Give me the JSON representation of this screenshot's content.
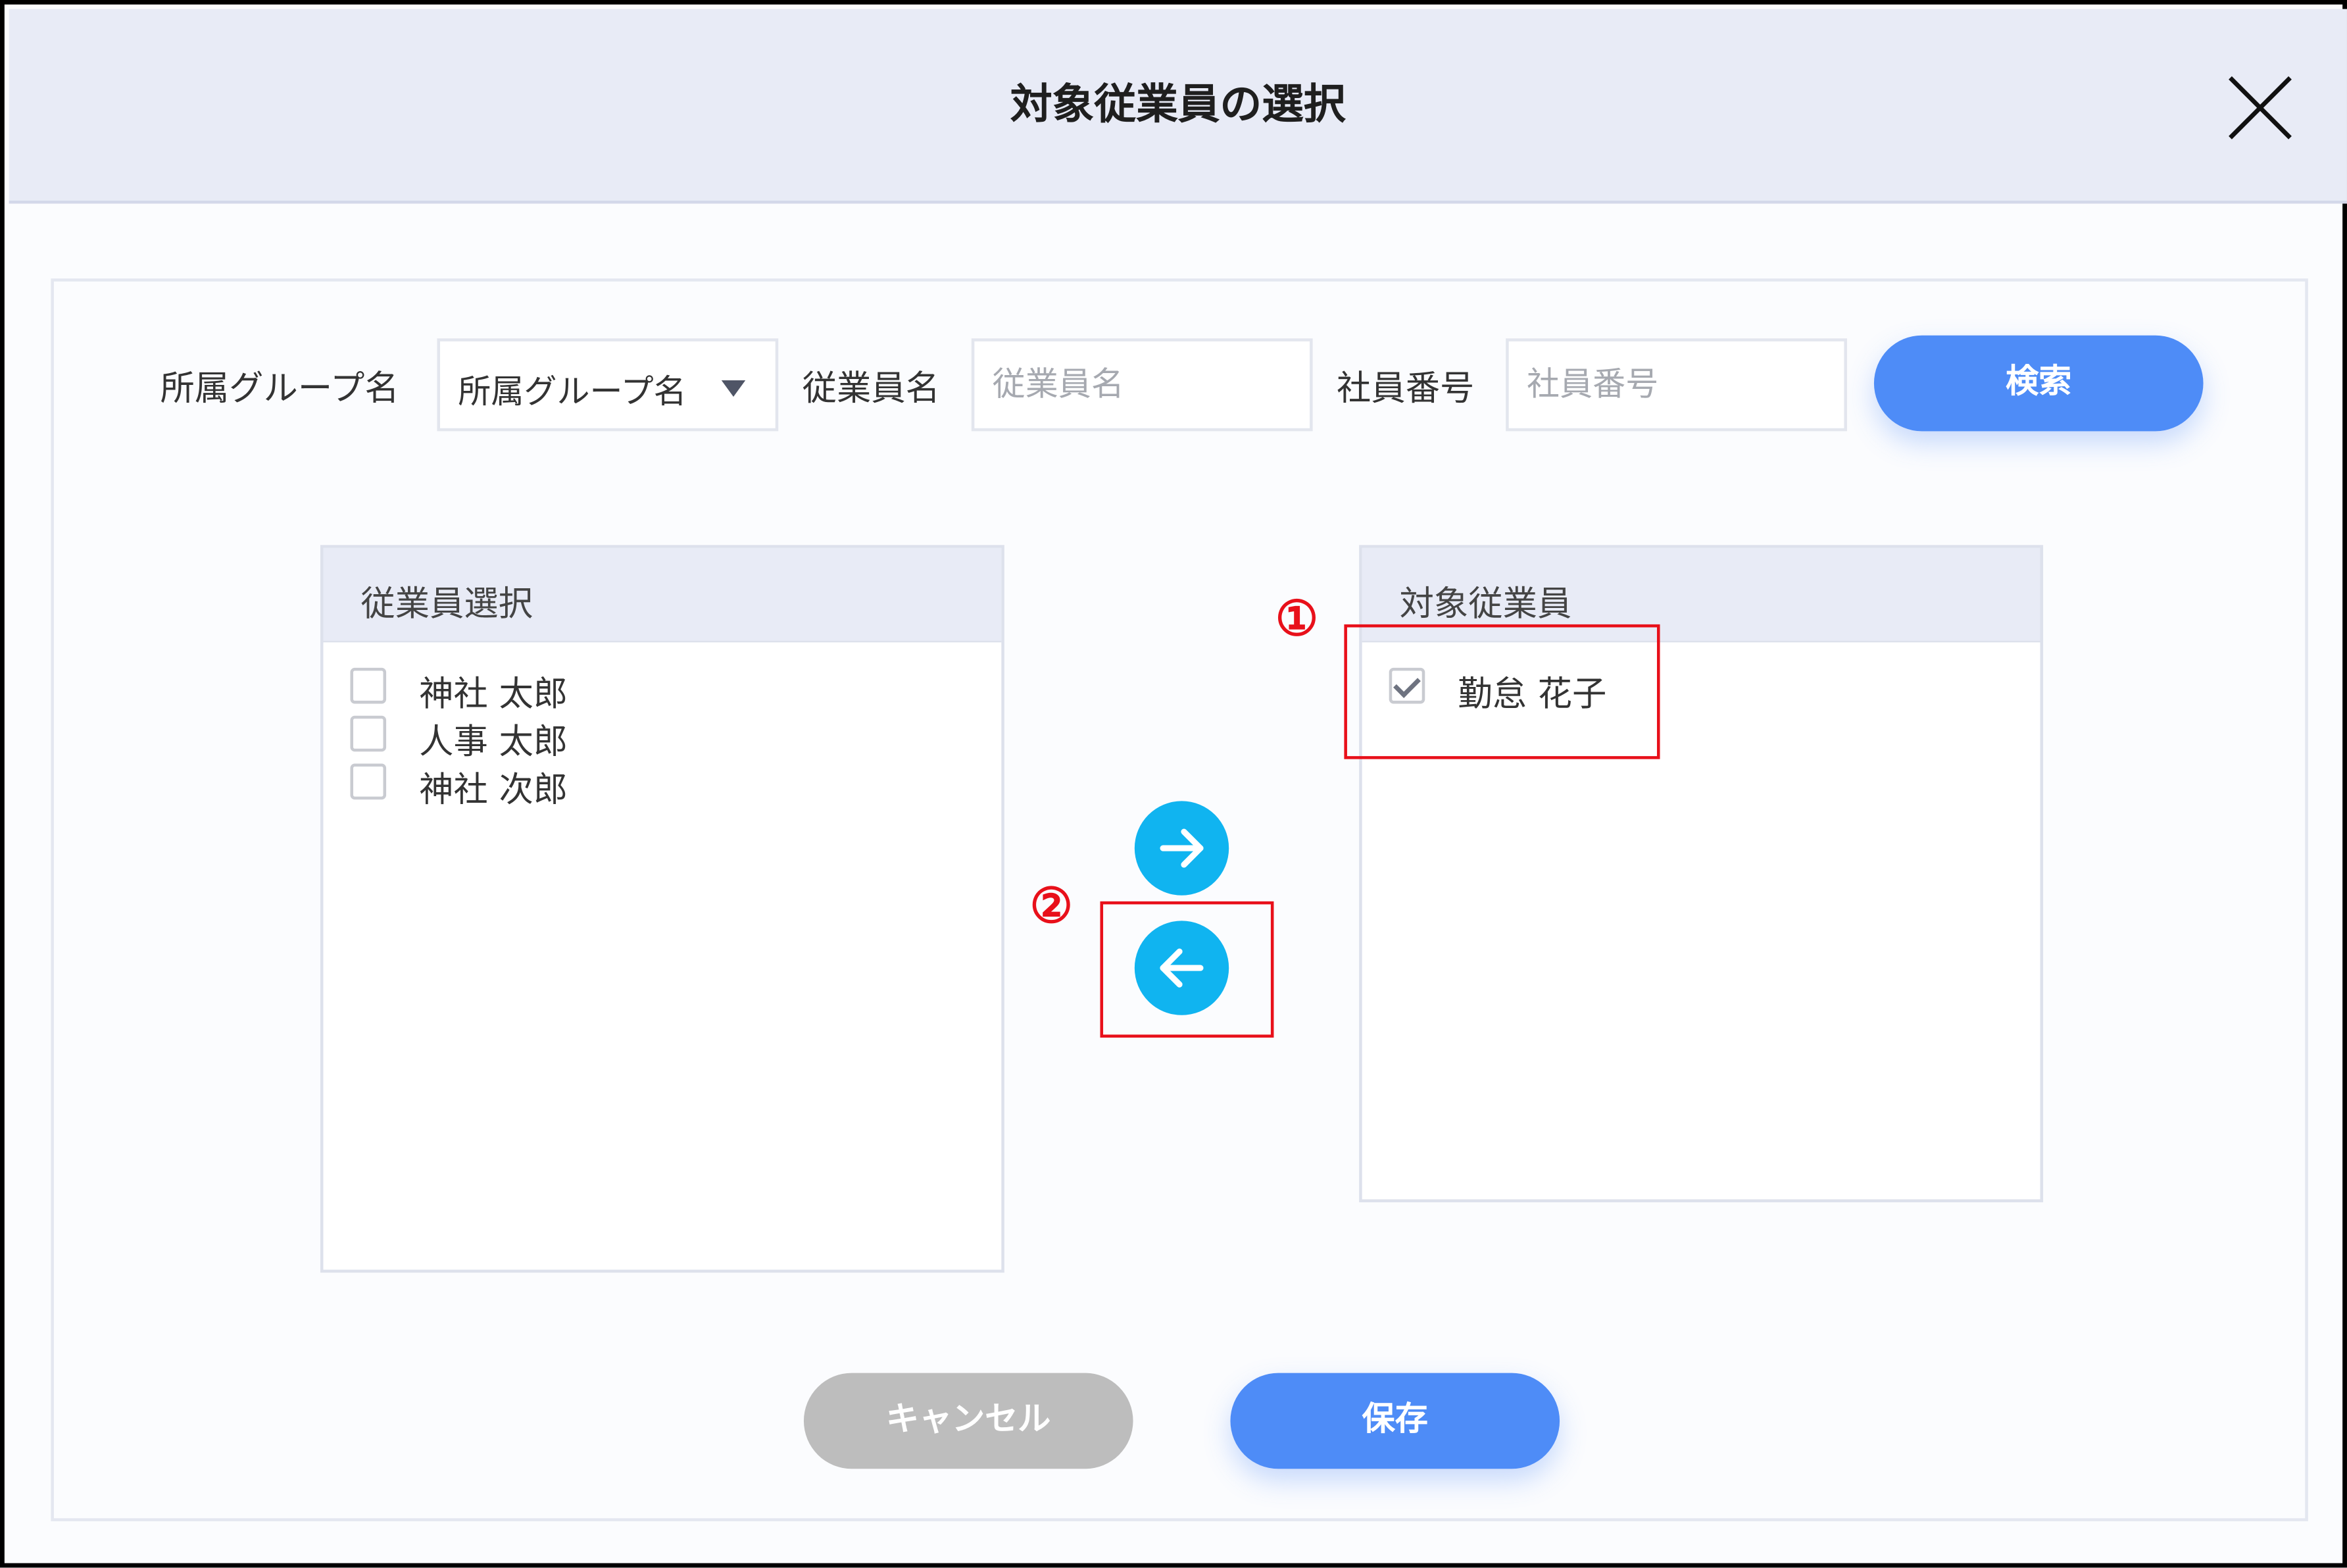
{
  "dialog": {
    "title": "対象従業員の選択"
  },
  "search": {
    "group_label": "所属グループ名",
    "group_select_value": "所属グループ名",
    "employee_name_label": "従業員名",
    "employee_name_placeholder": "従業員名",
    "employee_number_label": "社員番号",
    "employee_number_placeholder": "社員番号",
    "search_button": "検索"
  },
  "left_panel": {
    "title": "従業員選択",
    "items": [
      {
        "label": "神社 太郎",
        "checked": false
      },
      {
        "label": "人事 太郎",
        "checked": false
      },
      {
        "label": "神社 次郎",
        "checked": false
      }
    ]
  },
  "right_panel": {
    "title": "対象従業員",
    "items": [
      {
        "label": "勤怠 花子",
        "checked": true
      }
    ]
  },
  "transfer": {
    "add_icon": "arrow-right-icon",
    "remove_icon": "arrow-left-icon"
  },
  "annotations": {
    "marker_1": "①",
    "marker_2": "②"
  },
  "footer": {
    "cancel_button": "キャンセル",
    "save_button": "保存"
  },
  "colors": {
    "primary": "#4e8cf7",
    "transfer_button": "#10b4f0",
    "cancel_button": "#bdbdbd",
    "annotation": "#e8101a",
    "header_bg": "#e8ebf6"
  }
}
